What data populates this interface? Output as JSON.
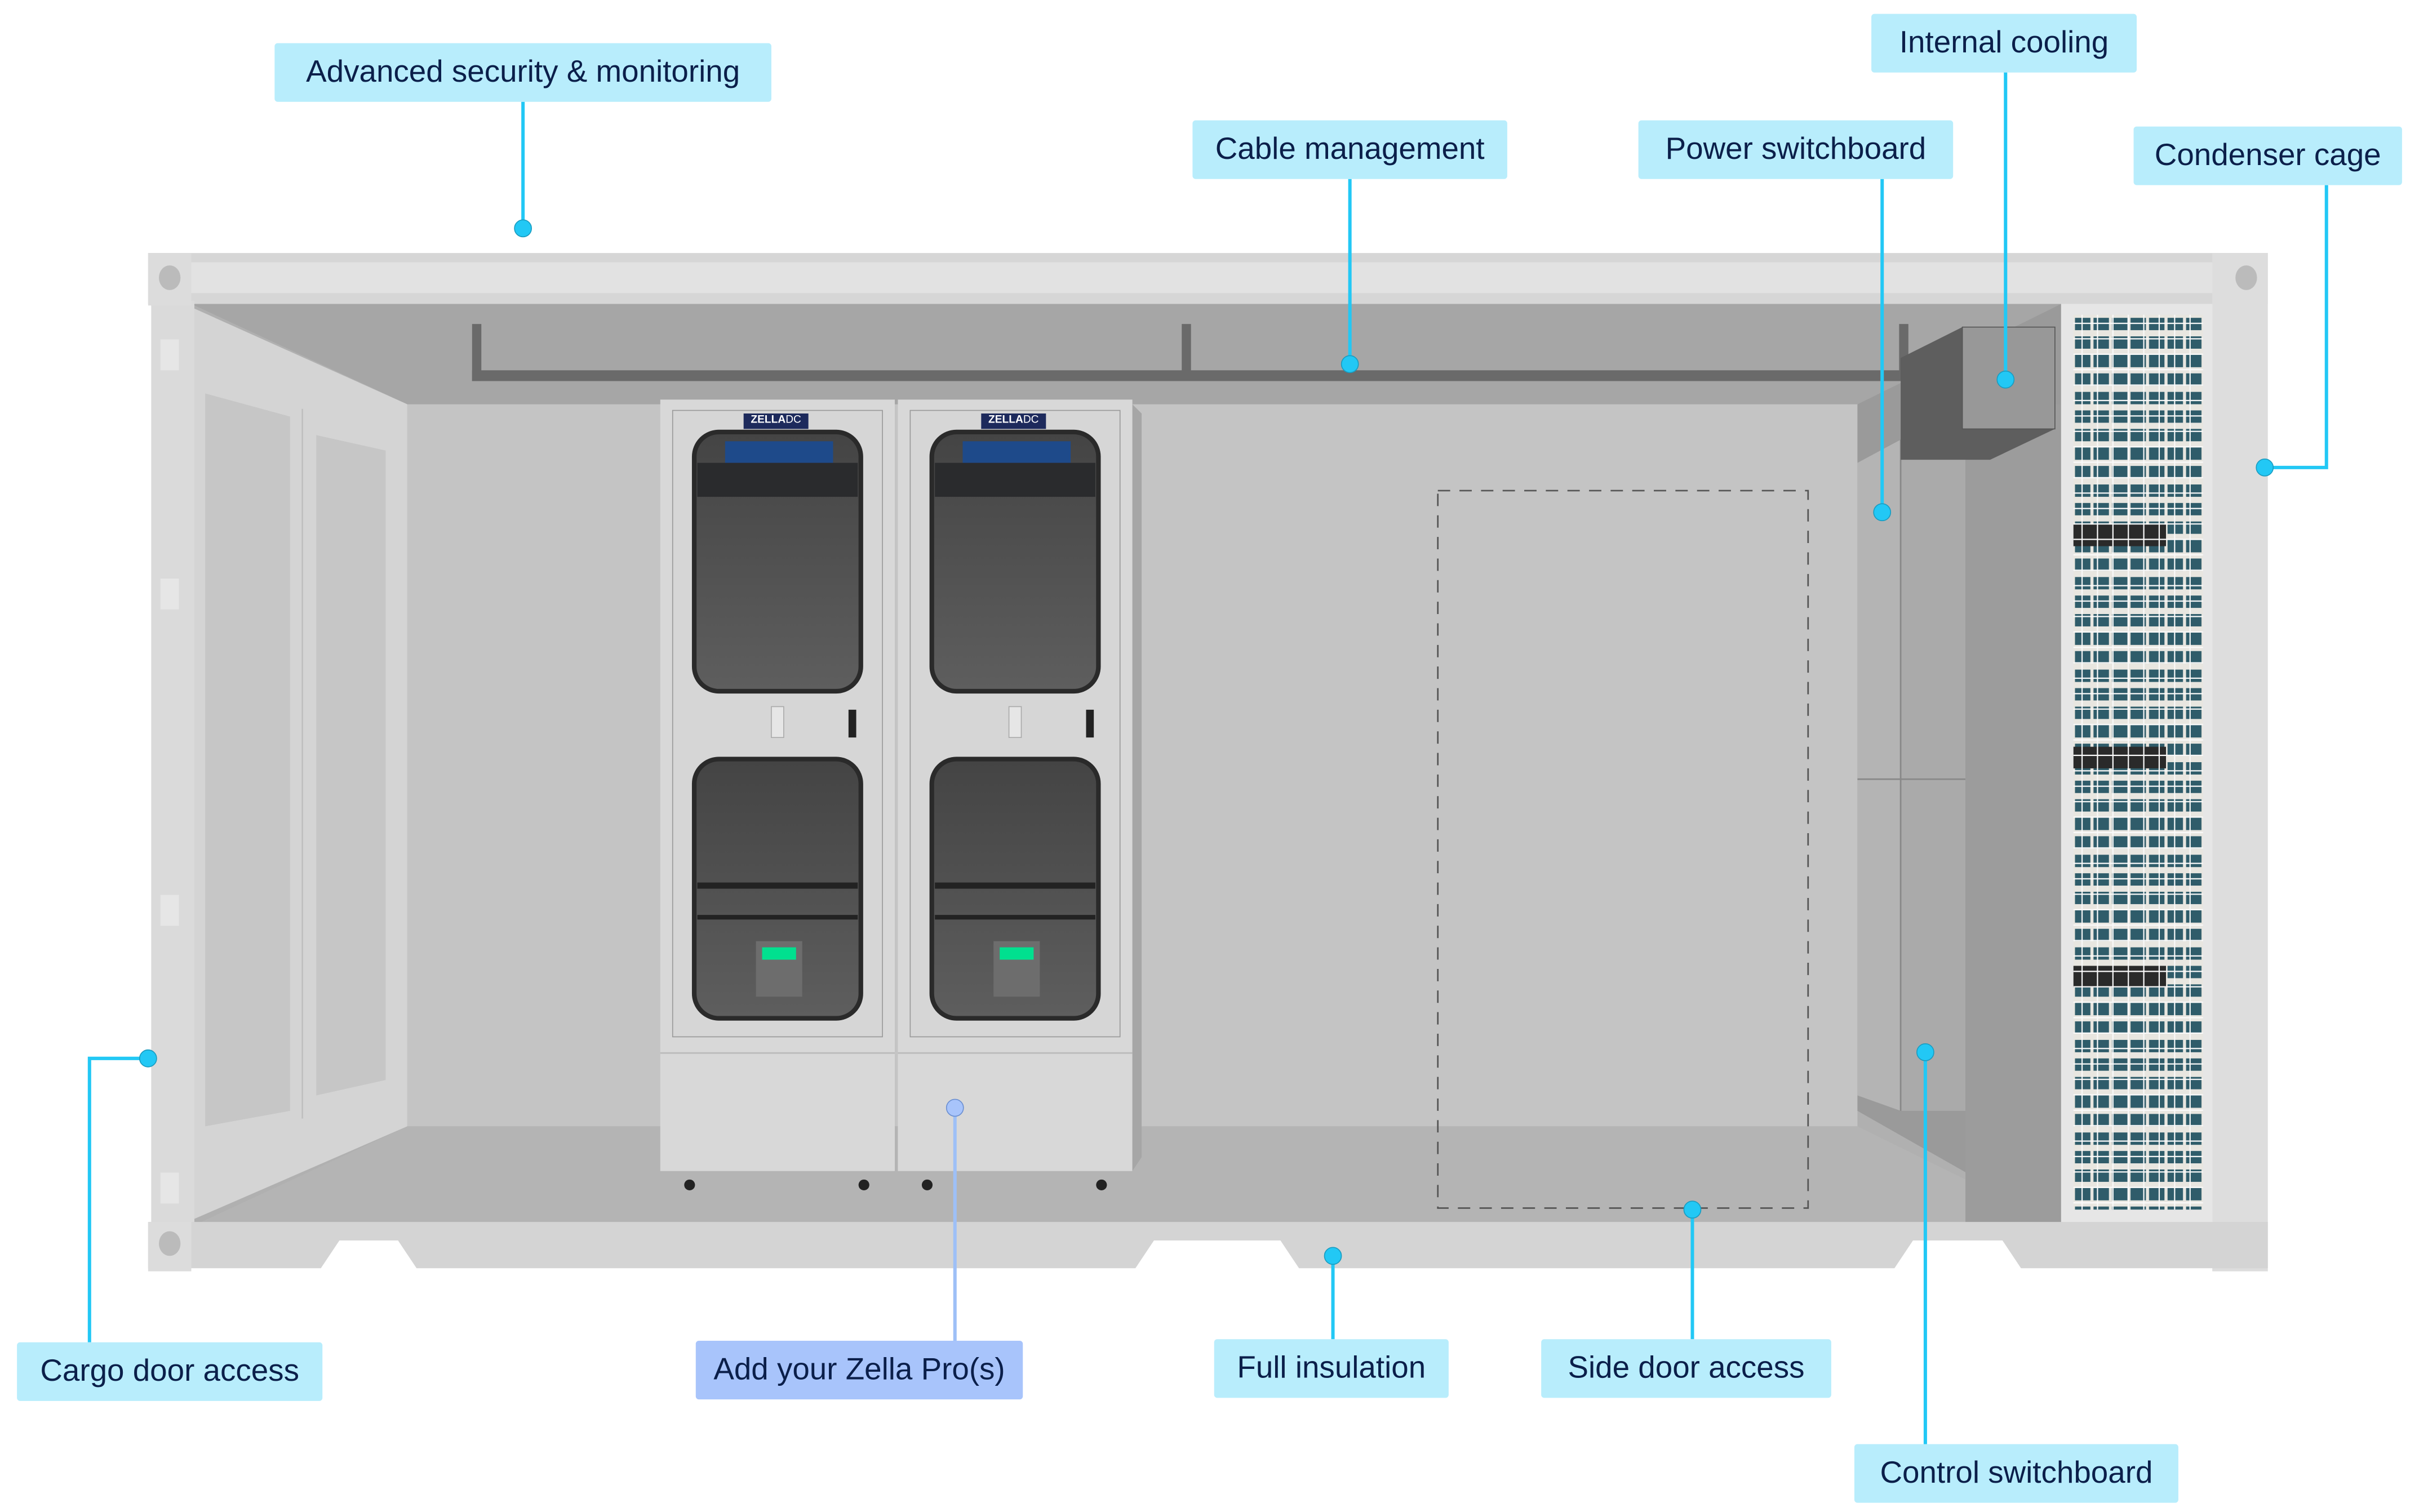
{
  "diagram": {
    "subject": "Container data center with Zella DC cabinets",
    "callouts": [
      {
        "id": "advanced-security",
        "label": "Advanced security & monitoring"
      },
      {
        "id": "cable-management",
        "label": "Cable management"
      },
      {
        "id": "power-switchboard",
        "label": "Power switchboard"
      },
      {
        "id": "internal-cooling",
        "label": "Internal cooling"
      },
      {
        "id": "condenser-cage",
        "label": "Condenser cage"
      },
      {
        "id": "cargo-door-access",
        "label": "Cargo door access"
      },
      {
        "id": "add-zella-pro",
        "label": "Add your Zella Pro(s)"
      },
      {
        "id": "full-insulation",
        "label": "Full insulation"
      },
      {
        "id": "side-door-access",
        "label": "Side door access"
      },
      {
        "id": "control-switchboard",
        "label": "Control switchboard"
      }
    ],
    "cabinets": [
      {
        "brand_left": "ZELLA",
        "brand_right": "DC"
      },
      {
        "brand_left": "ZELLA",
        "brand_right": "DC"
      }
    ],
    "colors": {
      "callout_bg": "#b8edfc",
      "callout_bg_highlight": "#a8c4fb",
      "callout_text": "#0b1f4a",
      "leader_line": "#22c8f5",
      "leader_line_highlight": "#9ec0f7",
      "cabinet_display": "#00e08f",
      "brand_badge": "#1d2a5c"
    }
  }
}
